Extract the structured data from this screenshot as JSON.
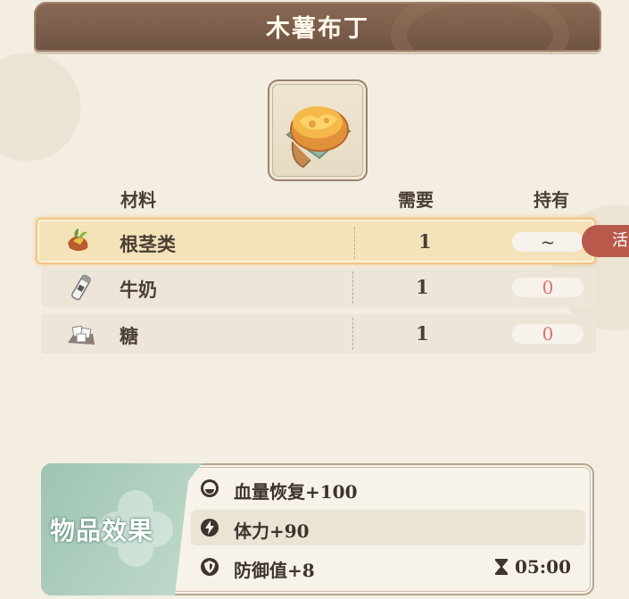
{
  "title": "木薯布丁",
  "columns": {
    "material": "材料",
    "need": "需要",
    "have": "持有"
  },
  "ingredients": [
    {
      "name": "根茎类",
      "need": "1",
      "have": "~",
      "icon": "root-vegetable-icon"
    },
    {
      "name": "牛奶",
      "need": "1",
      "have": "0",
      "icon": "milk-bottle-icon"
    },
    {
      "name": "糖",
      "need": "1",
      "have": "0",
      "icon": "sugar-icon"
    }
  ],
  "side_tab": {
    "label": "活"
  },
  "effects": {
    "title": "物品效果",
    "items": [
      {
        "text": "血量恢复+100",
        "icon": "heal-icon"
      },
      {
        "text": "体力+90",
        "icon": "stamina-icon"
      },
      {
        "text": "防御值+8",
        "icon": "shield-icon"
      }
    ],
    "duration": "05:00"
  },
  "colors": {
    "title_bar": "#7a5d4a",
    "highlight_border": "#f0c488",
    "missing_count": "#e06d6d"
  }
}
